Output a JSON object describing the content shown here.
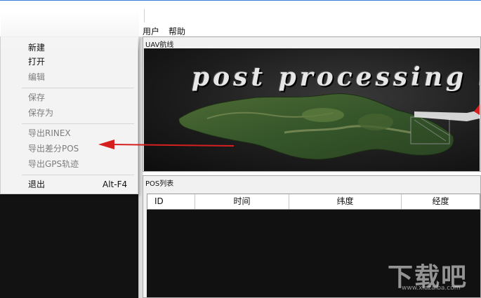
{
  "menubar": {
    "items": [
      "用户",
      "帮助"
    ]
  },
  "uav_panel": {
    "title": "UAV航线",
    "banner": "post processing s"
  },
  "pos_panel": {
    "title": "POS列表",
    "columns": [
      "ID",
      "时间",
      "纬度",
      "经度"
    ]
  },
  "file_menu": {
    "items": [
      {
        "label": "新建",
        "enabled": true
      },
      {
        "label": "打开",
        "enabled": true
      },
      {
        "label": "编辑",
        "enabled": false
      },
      {
        "label": "保存",
        "enabled": false
      },
      {
        "label": "保存为",
        "enabled": false
      },
      {
        "label": "导出RINEX",
        "enabled": false
      },
      {
        "label": "导出差分POS",
        "enabled": false
      },
      {
        "label": "导出GPS轨迹",
        "enabled": false
      },
      {
        "label": "退出",
        "enabled": true,
        "shortcut": "Alt-F4"
      }
    ]
  },
  "annotation": {
    "color": "#d62020"
  },
  "watermark": {
    "text": "下载吧",
    "url": "www.xiazaiba.com"
  }
}
